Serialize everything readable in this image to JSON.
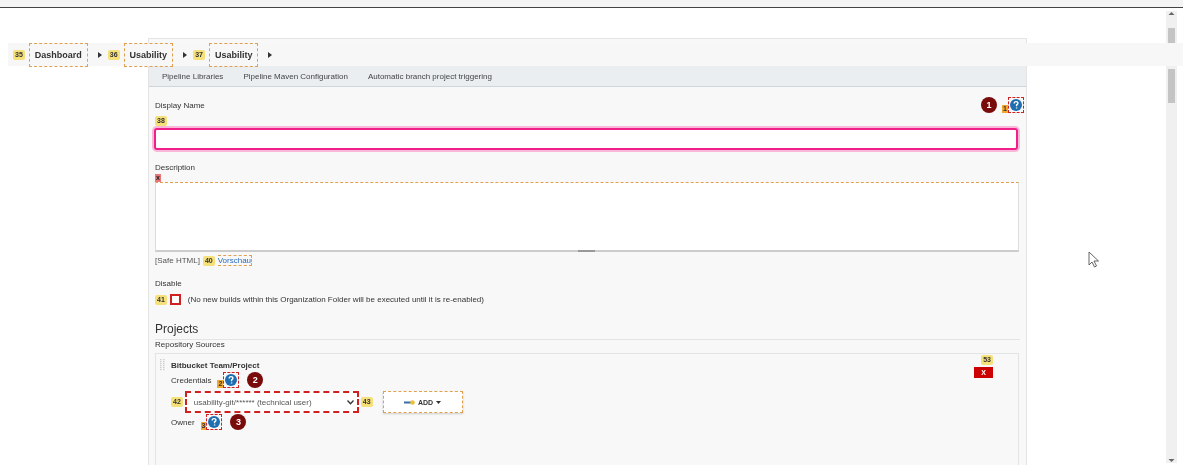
{
  "breadcrumbs": [
    {
      "tag": "35",
      "label": "Dashboard"
    },
    {
      "tag": "36",
      "label": "Usability"
    },
    {
      "tag": "37",
      "label": "Usability"
    }
  ],
  "tabs": [
    {
      "label": "Pipeline Libraries"
    },
    {
      "label": "Pipeline Maven Configuration"
    },
    {
      "label": "Automatic branch project triggering"
    }
  ],
  "display_name": {
    "label": "Display Name",
    "tag": "38",
    "help_tag": "1",
    "callout": "1"
  },
  "description": {
    "label": "Description",
    "tag": "x"
  },
  "safe_html": "[Safe HTML]",
  "preview": {
    "tag": "40",
    "label": "Vorschau"
  },
  "disable": {
    "label": "Disable",
    "tag": "41",
    "checked": false,
    "note": "(No new builds within this Organization Folder will be executed until it is re-enabled)"
  },
  "projects_heading": "Projects",
  "repository_sources": "Repository Sources",
  "source": {
    "title": "Bitbucket Team/Project",
    "delete_tag": "53",
    "delete_label": "X",
    "credentials": {
      "label": "Credentials",
      "help_tag": "2",
      "callout": "2",
      "select_tag": "42",
      "value": "usability-git/****** (technical user)",
      "add_tag": "43",
      "add_label": "ADD"
    },
    "owner": {
      "label": "Owner",
      "help_tag": "3",
      "callout": "3"
    }
  }
}
